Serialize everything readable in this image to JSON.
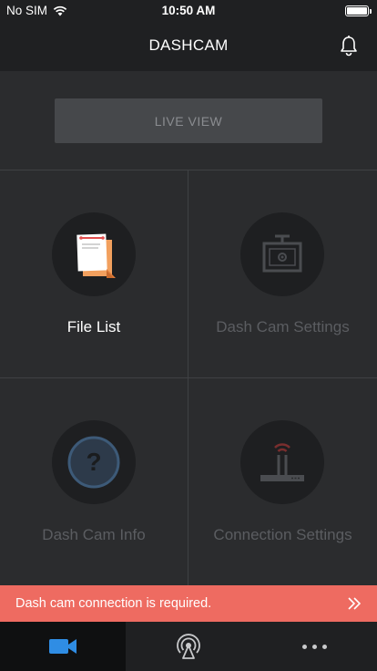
{
  "status_bar": {
    "carrier": "No SIM",
    "time": "10:50 AM",
    "icons": [
      "wifi-icon",
      "battery-icon"
    ]
  },
  "nav": {
    "title": "DASHCAM",
    "icon": "bell-icon"
  },
  "live_view": {
    "label": "LIVE VIEW",
    "enabled": false
  },
  "menu": [
    {
      "label": "File List",
      "icon": "file-list-icon",
      "enabled": true
    },
    {
      "label": "Dash Cam Settings",
      "icon": "dashcam-settings-icon",
      "enabled": false
    },
    {
      "label": "Dash Cam Info",
      "icon": "question-icon",
      "enabled": false
    },
    {
      "label": "Connection Settings",
      "icon": "router-icon",
      "enabled": false
    }
  ],
  "alert": {
    "message": "Dash cam connection is required.",
    "icon": "double-chevron-right-icon",
    "color": "#ee6b61"
  },
  "tabs": [
    {
      "icon": "video-camera-icon",
      "selected": true
    },
    {
      "icon": "connection-signal-icon",
      "selected": false
    },
    {
      "icon": "more-icon",
      "selected": false
    }
  ],
  "colors": {
    "accent": "#2f8de4",
    "background": "#2b2c2e",
    "bar": "#1f2022"
  }
}
